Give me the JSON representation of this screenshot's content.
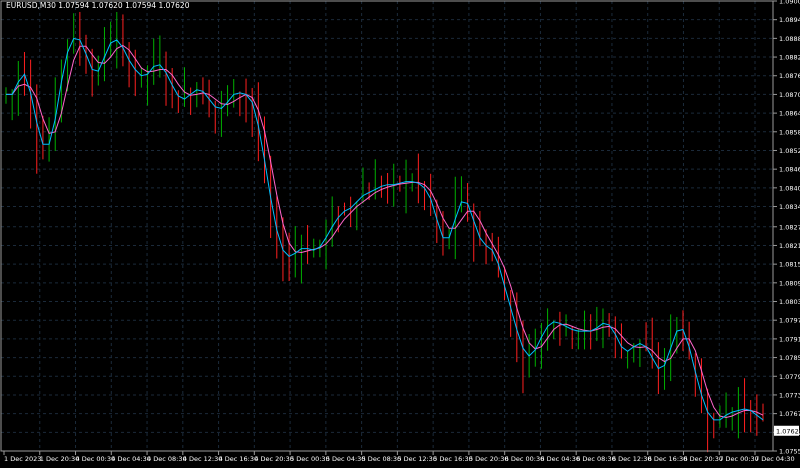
{
  "header": {
    "symbol_label": "EURUSD,M30",
    "ohlc_label": "1.07594 1.07620 1.07594 1.07620"
  },
  "colors": {
    "background": "#000000",
    "grid": "#1b2a3a",
    "frame": "#9a9a9a",
    "text": "#ffffff",
    "bull_candle": "#00b000",
    "bear_candle": "#ff2020",
    "ma_fast": "#00bfff",
    "ma_slow": "#ff66cc",
    "price_tag_bg": "#ffffff",
    "price_tag_text": "#000000"
  },
  "chart_data": {
    "type": "candlestick",
    "grid": true,
    "price_scale": {
      "position": "right",
      "ylim": [
        1.07555,
        1.09
      ],
      "ticks": [
        "1.09000",
        "1.08940",
        "1.08880",
        "1.08820",
        "1.08760",
        "1.08700",
        "1.08640",
        "1.08580",
        "1.08520",
        "1.08460",
        "1.08400",
        "1.08340",
        "1.08275",
        "1.08215",
        "1.08155",
        "1.08095",
        "1.08035",
        "1.07975",
        "1.07915",
        "1.07855",
        "1.07795",
        "1.07735",
        "1.07675",
        "1.07615",
        "1.07555"
      ]
    },
    "time_scale": {
      "ticks": [
        "1 Dec 2023",
        "1 Dec 20:30",
        "4 Dec 00:30",
        "4 Dec 04:30",
        "4 Dec 08:30",
        "4 Dec 12:30",
        "4 Dec 16:30",
        "4 Dec 20:30",
        "5 Dec 00:30",
        "5 Dec 04:30",
        "5 Dec 08:30",
        "5 Dec 12:30",
        "5 Dec 16:30",
        "5 Dec 20:30",
        "6 Dec 00:30",
        "6 Dec 04:30",
        "6 Dec 08:30",
        "6 Dec 12:30",
        "6 Dec 16:30",
        "6 Dec 20:30",
        "7 Dec 00:30",
        "7 Dec 04:30"
      ]
    },
    "current_price": "1.07620",
    "trend_path": [
      1.087,
      1.087,
      1.0878,
      1.0875,
      1.0866,
      1.0856,
      1.0852,
      1.0856,
      1.0868,
      1.088,
      1.0887,
      1.0889,
      1.0886,
      1.088,
      1.0876,
      1.0879,
      1.0885,
      1.0888,
      1.0887,
      1.0883,
      1.0879,
      1.0877,
      1.0875,
      1.0878,
      1.088,
      1.0879,
      1.0875,
      1.0871,
      1.0868,
      1.0869,
      1.0871,
      1.0872,
      1.087,
      1.0867,
      1.0865,
      1.0866,
      1.0869,
      1.0871,
      1.087,
      1.087,
      1.0865,
      1.0855,
      1.0843,
      1.0831,
      1.0822,
      1.0818,
      1.0818,
      1.082,
      1.0821,
      1.082,
      1.082,
      1.0822,
      1.0826,
      1.0829,
      1.0832,
      1.0833,
      1.0834,
      1.0837,
      1.0838,
      1.0839,
      1.084,
      1.0841,
      1.0841,
      1.0841,
      1.0842,
      1.0842,
      1.0842,
      1.0841,
      1.0839,
      1.0834,
      1.0826,
      1.0822,
      1.0826,
      1.0834,
      1.0837,
      1.0833,
      1.0826,
      1.0822,
      1.0821,
      1.0819,
      1.0812,
      1.0805,
      1.0798,
      1.0791,
      1.0786,
      1.0786,
      1.079,
      1.0794,
      1.0797,
      1.0797,
      1.0796,
      1.0795,
      1.0794,
      1.0794,
      1.0794,
      1.0794,
      1.0796,
      1.0797,
      1.0795,
      1.0791,
      1.0787,
      1.0788,
      1.079,
      1.079,
      1.0788,
      1.0783,
      1.0781,
      1.0785,
      1.0792,
      1.0796,
      1.0793,
      1.0785,
      1.0777,
      1.077,
      1.0766,
      1.0765,
      1.0766,
      1.0768,
      1.0768,
      1.0769,
      1.0769,
      1.0768,
      1.0766,
      1.0765
    ],
    "ma_fast_label": "",
    "ma_slow_label": ""
  }
}
